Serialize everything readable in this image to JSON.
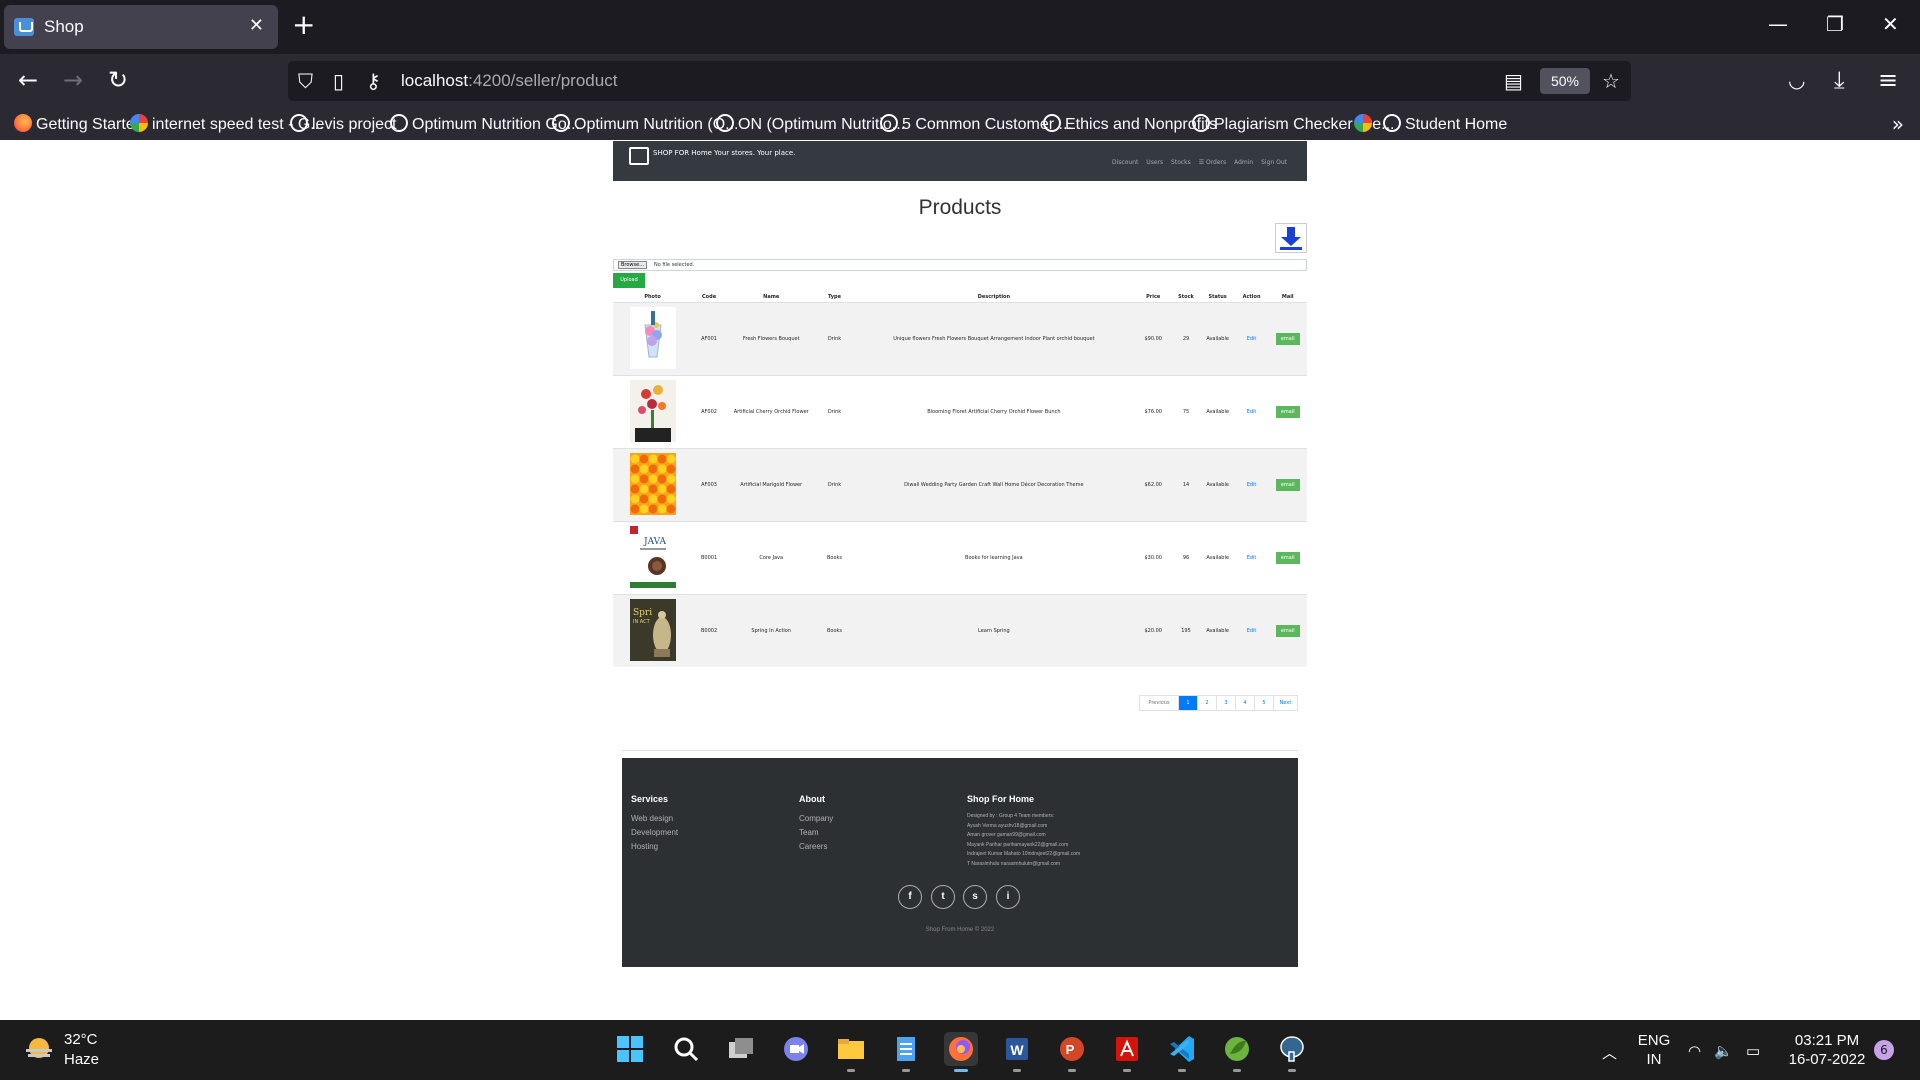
{
  "browser": {
    "tab_title": "Shop",
    "url_host": "localhost",
    "url_path": ":4200/seller/product",
    "zoom": "50%",
    "bookmarks": [
      {
        "label": "Getting Started",
        "icon": "firefox-icon"
      },
      {
        "label": "internet speed test - G...",
        "icon": "google-icon"
      },
      {
        "label": "levis project",
        "icon": "globe-icon"
      },
      {
        "label": "Optimum Nutrition Go...",
        "icon": "globe-icon"
      },
      {
        "label": "Optimum Nutrition (O...",
        "icon": "globe-icon"
      },
      {
        "label": "ON (Optimum Nutritio...",
        "icon": "globe-icon"
      },
      {
        "label": "5 Common Customer ...",
        "icon": "globe-icon"
      },
      {
        "label": "Ethics and Nonprofits",
        "icon": "globe-icon"
      },
      {
        "label": "Plagiarism Checker Fre...",
        "icon": "globe-icon"
      },
      {
        "label": "",
        "icon": "google-icon"
      },
      {
        "label": "Student Home",
        "icon": "globe-icon"
      }
    ]
  },
  "shop_nav": {
    "brand": "SHOP FOR Home Your stores. Your place.",
    "links": [
      "Discount",
      "Users",
      "Stocks",
      "☰ Orders",
      "Admin",
      "Sign Out"
    ]
  },
  "page": {
    "title": "Products",
    "browse_label": "Browse...",
    "no_file": "No file selected.",
    "upload_label": "Upload"
  },
  "table": {
    "headers": [
      "Photo",
      "Code",
      "Name",
      "Type",
      "Description",
      "Price",
      "Stock",
      "Status",
      "Action",
      "Mail"
    ],
    "rows": [
      {
        "code": "AF001",
        "name": "Fresh Flowers Bouquet",
        "type": "Drink",
        "description": "Unique flowers Fresh Flowers Bouquet Arrangement Indoor Plant orchid bouquet",
        "price": "$90.00",
        "stock": "29",
        "status": "Available",
        "action": "Edit",
        "mail": "email",
        "photo": "bouquet"
      },
      {
        "code": "AF002",
        "name": "Artificial Cherry Orchid Flower",
        "type": "Drink",
        "description": "Blooming Floret Artificial Cherry Orchid Flower Bunch",
        "price": "$76.00",
        "stock": "75",
        "status": "Available",
        "action": "Edit",
        "mail": "email",
        "photo": "orchid"
      },
      {
        "code": "AF003",
        "name": "Artificial Marigold Flower",
        "type": "Drink",
        "description": "Diwali Wedding Party Garden Craft Wall Home Décor Decoration Theme",
        "price": "$62.00",
        "stock": "14",
        "status": "Available",
        "action": "Edit",
        "mail": "email",
        "photo": "marigold"
      },
      {
        "code": "B0001",
        "name": "Core Java",
        "type": "Books",
        "description": "Books for learning Java",
        "price": "$30.00",
        "stock": "96",
        "status": "Available",
        "action": "Edit",
        "mail": "email",
        "photo": "java-book"
      },
      {
        "code": "B0002",
        "name": "Spring In Action",
        "type": "Books",
        "description": "Learn Spring",
        "price": "$20.00",
        "stock": "195",
        "status": "Available",
        "action": "Edit",
        "mail": "email",
        "photo": "spring-book"
      }
    ]
  },
  "pagination": {
    "items": [
      "Previous",
      "1",
      "2",
      "3",
      "4",
      "5",
      "Next"
    ],
    "active": "1"
  },
  "footer": {
    "services": {
      "title": "Services",
      "links": [
        "Web design",
        "Development",
        "Hosting"
      ]
    },
    "about": {
      "title": "About",
      "links": [
        "Company",
        "Team",
        "Careers"
      ]
    },
    "shop": {
      "title": "Shop For Home",
      "lines": [
        "Designed by : Group 4 Team members:",
        "Ayush Verma ayushv18@gmail.com",
        "Aman grover gaman99@gmail.com",
        "Mayank Parihar parihamayank22@gmail.com",
        "Indrajeet Kumar Mahato 10indrajeet22@gmail.com",
        "T Narasimhulu narasimhulutn@gmail.com"
      ]
    },
    "social": [
      "f",
      "t",
      "s",
      "i"
    ],
    "copyright": "Shop From Home © 2022"
  },
  "taskbar": {
    "temperature": "32°C",
    "weather": "Haze",
    "lang_top": "ENG",
    "lang_bottom": "IN",
    "time": "03:21 PM",
    "date": "16-07-2022",
    "notifications": "6"
  },
  "colors": {
    "nav_dark": "#343a40",
    "footer_dark": "#2d3033",
    "upload_green": "#28a745",
    "email_green": "#5cb85c",
    "link_blue": "#007bff"
  }
}
